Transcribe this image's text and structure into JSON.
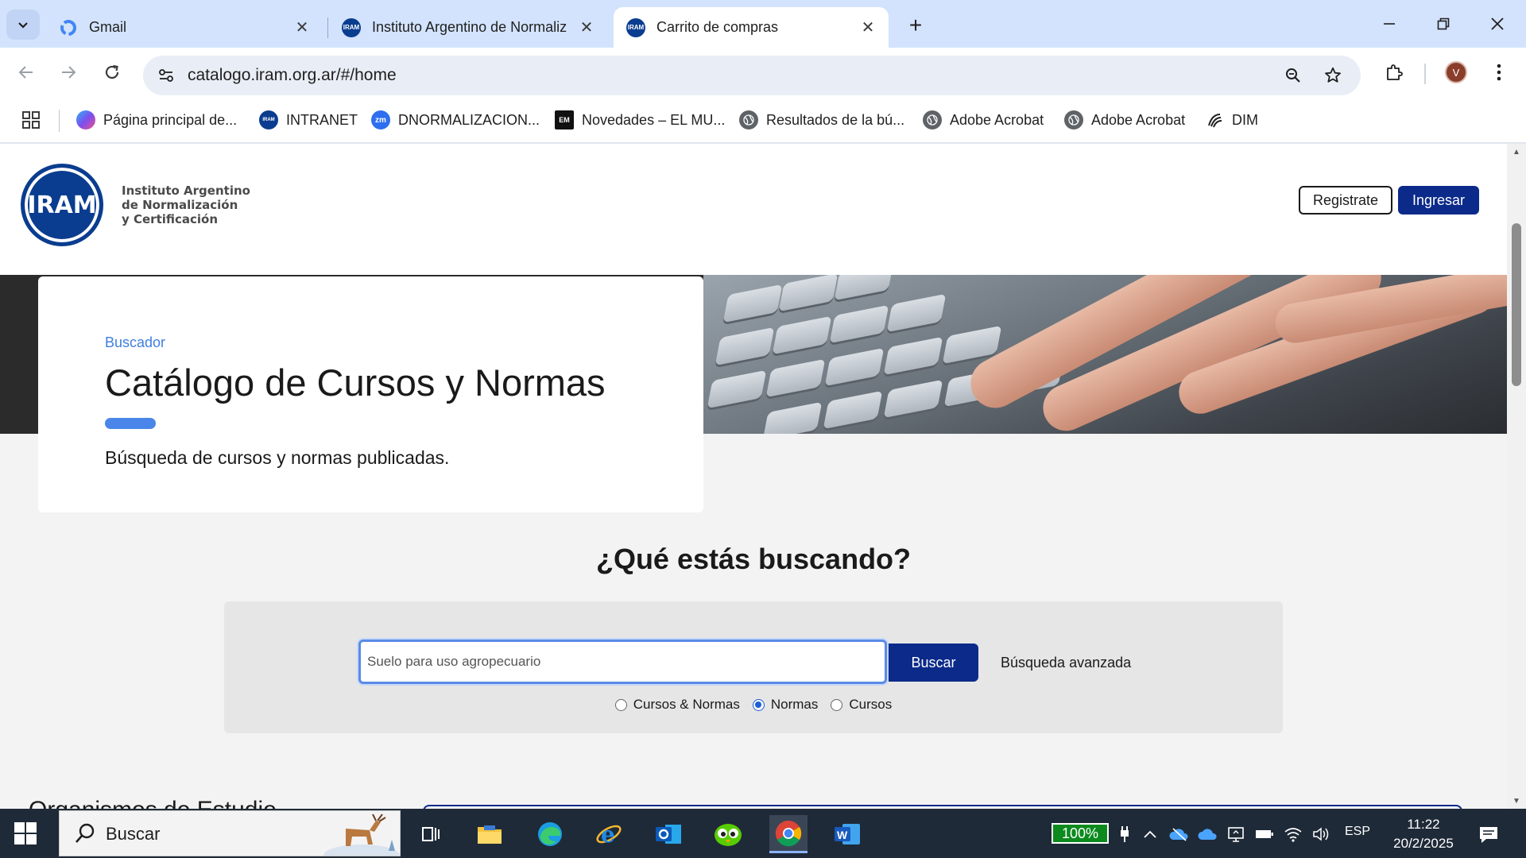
{
  "browser": {
    "tabs": [
      {
        "title": "Gmail",
        "favicon": "google-icon"
      },
      {
        "title": "Instituto Argentino de Normaliz",
        "favicon": "iram-favicon"
      },
      {
        "title": "Carrito de compras",
        "favicon": "iram-favicon",
        "active": true
      }
    ],
    "address": "catalogo.iram.org.ar/#/home",
    "bookmarks": [
      {
        "label": "Página principal de...",
        "icon": "copilot-icon"
      },
      {
        "label": "INTRANET",
        "icon": "iram-favicon"
      },
      {
        "label": "DNORMALIZACION...",
        "icon": "zoom-icon",
        "badge": "zm"
      },
      {
        "label": "Novedades – EL MU...",
        "icon": "news-icon",
        "badge": "EM"
      },
      {
        "label": "Resultados de la bú...",
        "icon": "globe-icon"
      },
      {
        "label": "Adobe Acrobat",
        "icon": "globe-icon"
      },
      {
        "label": "Adobe Acrobat",
        "icon": "globe-icon"
      },
      {
        "label": "DIM",
        "icon": "dim-icon"
      }
    ],
    "profile_initial": "V"
  },
  "site": {
    "logo_text": "IRAM",
    "logo_caption": [
      "Instituto Argentino",
      "de Normalización",
      "y Certificación"
    ],
    "register_label": "Registrate",
    "login_label": "Ingresar",
    "hero": {
      "kicker": "Buscador",
      "title": "Catálogo de Cursos y Normas",
      "subtitle": "Búsqueda de cursos y normas publicadas."
    },
    "search": {
      "question": "¿Qué estás buscando?",
      "query": "Suelo para uso agropecuario",
      "button": "Buscar",
      "advanced": "Búsqueda avanzada",
      "options": [
        {
          "label": "Cursos & Normas",
          "checked": false
        },
        {
          "label": "Normas",
          "checked": true
        },
        {
          "label": "Cursos",
          "checked": false
        }
      ]
    },
    "next_section": "Organismos de Estudio"
  },
  "taskbar": {
    "search_label": "Buscar",
    "battery": "100%",
    "language": "ESP",
    "time": "11:22",
    "date": "20/2/2025"
  },
  "colors": {
    "brand_blue": "#0b2a8a",
    "accent_blue": "#4a86ea",
    "tab_strip": "#d3e3fd"
  }
}
